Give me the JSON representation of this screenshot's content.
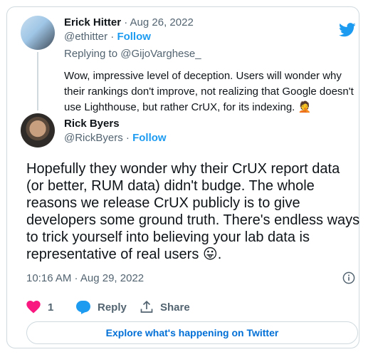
{
  "reply_tweet": {
    "name": "Erick Hitter",
    "date": "· Aug 26, 2022",
    "handle": "@ethitter",
    "separator": " · ",
    "follow": "Follow",
    "replying_prefix": "Replying to ",
    "replying_to": "@GijoVarghese_",
    "text": "Wow, impressive level of deception. Users will wonder why their rankings don't improve, not realizing that Google doesn't use Lighthouse, but rather CrUX, for its indexing. 🤦"
  },
  "main_tweet": {
    "name": "Rick Byers",
    "handle": "@RickByers",
    "separator": " · ",
    "follow": "Follow",
    "text": "Hopefully they wonder why their CrUX report data (or better, RUM data) didn't budge. The whole reasons we release CrUX publicly is to give developers some ground truth. There's endless ways to trick yourself into believing your lab data is representative of real users 😛.",
    "timestamp": "10:16 AM · Aug 29, 2022"
  },
  "actions": {
    "like_count": "1",
    "reply_label": "Reply",
    "share_label": "Share"
  },
  "explore_label": "Explore what's happening on Twitter",
  "icons": {
    "brand": "twitter-bird-icon",
    "like": "heart-icon",
    "reply": "speech-bubble-icon",
    "share": "share-icon",
    "info": "info-icon"
  },
  "colors": {
    "accent": "#1d9bf0",
    "like": "#f91880",
    "muted": "#536471",
    "border": "#cfd9de"
  }
}
